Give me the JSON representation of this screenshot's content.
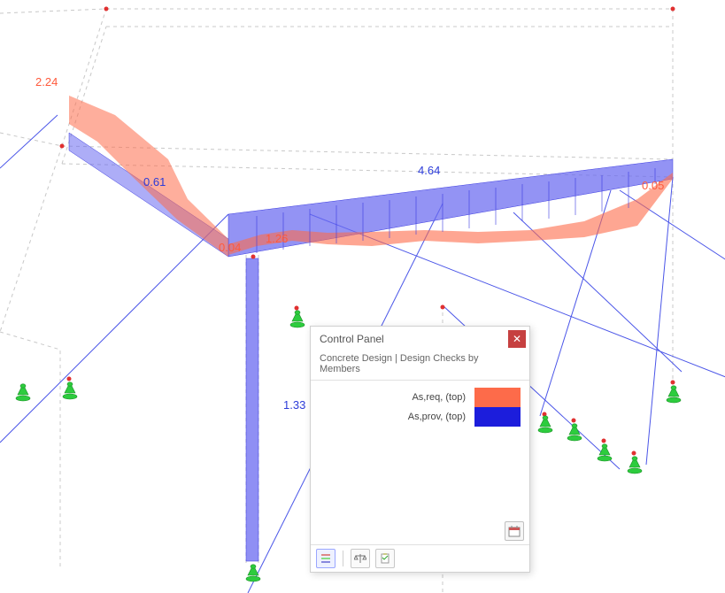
{
  "panel": {
    "title": "Control Panel",
    "subtitle": "Concrete Design | Design Checks by Members",
    "legend": {
      "req": {
        "label": "As,req, (top)"
      },
      "prov": {
        "label": "As,prov, (top)"
      }
    }
  },
  "viewport": {
    "labels": {
      "v224": "2.24",
      "v061": "0.61",
      "v004": "0.04",
      "v126": "1.26",
      "v464": "4.64",
      "v005": "0.05",
      "v133": "1.33"
    }
  },
  "colors": {
    "legend_red": "#fd6b4a",
    "legend_blue": "#1c1ddc",
    "label_red": "#ff5a3c",
    "label_blue": "#2b3bd8",
    "support_green": "#2dcc3e",
    "wire_gray": "#cfcfcf",
    "node_red": "#e03030"
  }
}
